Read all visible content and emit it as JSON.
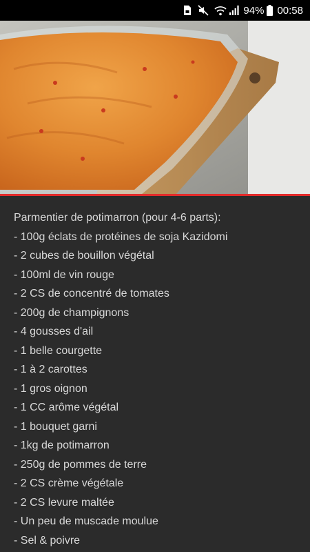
{
  "status_bar": {
    "battery_percent": "94%",
    "time": "00:58",
    "icons": [
      "sim-icon",
      "mute-icon",
      "wifi-icon",
      "signal-icon",
      "battery-icon"
    ]
  },
  "video": {
    "thumbnail": "parmentier-dish-photo",
    "progress_fraction": 1.0,
    "progress_color": "#e32b2b"
  },
  "description": {
    "lines": [
      "Parmentier de potimarron (pour 4-6 parts):",
      "- 100g éclats de protéines de soja Kazidomi",
      "- 2 cubes de bouillon végétal",
      "- 100ml de vin rouge",
      "- 2 CS de concentré de tomates",
      "- 200g de champignons",
      "- 4 gousses d'ail",
      "- 1 belle courgette",
      "- 1 à 2 carottes",
      "- 1 gros oignon",
      "- 1 CC arôme végétal",
      "- 1 bouquet garni",
      "- 1kg de potimarron",
      "- 250g de pommes de terre",
      "- 2 CS crème végétale",
      "- 2 CS levure maltée",
      "- Un peu de muscade moulue",
      "- Sel & poivre"
    ]
  }
}
